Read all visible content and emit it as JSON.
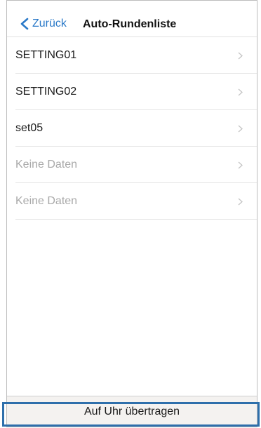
{
  "nav": {
    "back_label": "Zurück",
    "title": "Auto-Rundenliste",
    "back_icon": "chevron-left-icon"
  },
  "list": {
    "items": [
      {
        "label": "SETTING01",
        "empty": false
      },
      {
        "label": "SETTING02",
        "empty": false
      },
      {
        "label": "set05",
        "empty": false
      },
      {
        "label": "Keine Daten",
        "empty": true
      },
      {
        "label": "Keine Daten",
        "empty": true
      }
    ],
    "item_icon": "chevron-right-icon"
  },
  "footer": {
    "transfer_label": "Auf Uhr übertragen"
  },
  "colors": {
    "accent": "#2a79c8",
    "highlight": "#2e6fab",
    "empty_text": "#a9a9a9"
  }
}
